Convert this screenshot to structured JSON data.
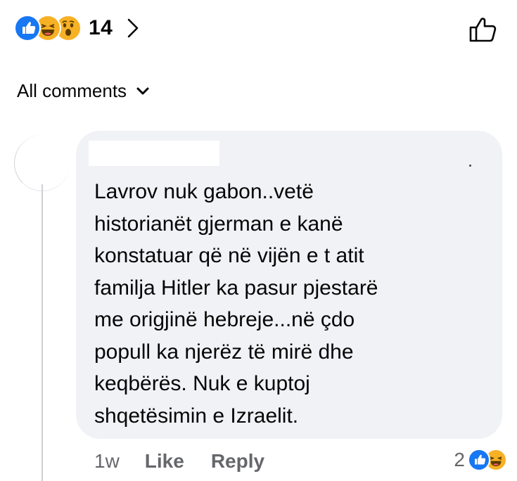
{
  "reactions": {
    "icons": [
      "like-icon",
      "haha-icon",
      "wow-icon"
    ],
    "count": "14",
    "colors": {
      "like": "#1877f2",
      "emoji": "#f7b125"
    }
  },
  "sort": {
    "label": "All comments"
  },
  "comment": {
    "author_name": "",
    "text_lines": [
      "Lavrov nuk gabon..vetë",
      "historianët gjerman e kanë",
      "konstatuar që në vijën e t atit",
      "familja Hitler ka pasur pjestarë",
      "me origjinë hebreje...në çdo",
      "popull ka njerëz të mirë dhe",
      "keqbërës. Nuk e kuptoj",
      "shqetësimin e Izraelit."
    ],
    "time": "1w",
    "like_label": "Like",
    "reply_label": "Reply",
    "reaction_count": "2",
    "reaction_icons": [
      "like-icon",
      "haha-icon"
    ]
  }
}
